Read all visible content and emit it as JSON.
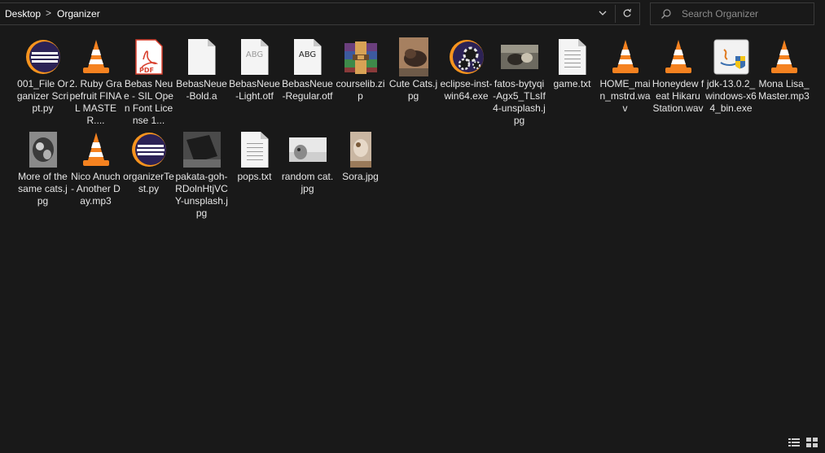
{
  "window": {
    "bg": "#191919",
    "text_color": "#e6e6e6"
  },
  "address_bar": {
    "breadcrumbs": [
      "Desktop",
      "Organizer"
    ],
    "separator": ">",
    "dropdown_glyph": "chevron-down-icon",
    "refresh_glyph": "refresh-icon"
  },
  "search": {
    "placeholder": "Search Organizer",
    "value": ""
  },
  "items": [
    {
      "label": "001_File Organizer Script.py",
      "icon": "python-eclipse-icon"
    },
    {
      "label": "2. Ruby Grapefruit FINAL MASTER....",
      "icon": "vlc-cone-icon"
    },
    {
      "label": "Bebas Neue - SIL Open Font License 1...",
      "icon": "pdf-icon"
    },
    {
      "label": "BebasNeue-Bold.a",
      "icon": "blank-file-icon"
    },
    {
      "label": "BebasNeue-Light.otf",
      "icon": "font-file-icon"
    },
    {
      "label": "BebasNeue-Regular.otf",
      "icon": "font-file-icon"
    },
    {
      "label": "courselib.zip",
      "icon": "archive-icon"
    },
    {
      "label": "Cute Cats.jpg",
      "icon": "photo-icon"
    },
    {
      "label": "eclipse-inst-win64.exe",
      "icon": "eclipse-installer-icon"
    },
    {
      "label": "fatos-bytyqi-Agx5_TLsIf4-unsplash.jpg",
      "icon": "photo-icon"
    },
    {
      "label": "game.txt",
      "icon": "text-file-icon"
    },
    {
      "label": "HOME_main_mstrd.wav",
      "icon": "vlc-cone-icon"
    },
    {
      "label": "Honeydew feat Hikaru Station.wav",
      "icon": "vlc-cone-icon"
    },
    {
      "label": "jdk-13.0.2_windows-x64_bin.exe",
      "icon": "java-installer-icon"
    },
    {
      "label": "Mona Lisa_Master.mp3",
      "icon": "vlc-cone-icon"
    },
    {
      "label": "More of the same cats.jpg",
      "icon": "photo-icon"
    },
    {
      "label": "Nico Anuch - Another Day.mp3",
      "icon": "vlc-cone-icon"
    },
    {
      "label": "organizerTest.py",
      "icon": "python-eclipse-icon"
    },
    {
      "label": "pakata-goh-RDolnHtjVCY-unsplash.jpg",
      "icon": "photo-icon"
    },
    {
      "label": "pops.txt",
      "icon": "text-file-icon"
    },
    {
      "label": "random cat.jpg",
      "icon": "photo-icon"
    },
    {
      "label": "Sora.jpg",
      "icon": "photo-icon"
    }
  ],
  "status_bar": {
    "view_buttons": [
      "details-view-icon",
      "large-icons-view-icon"
    ]
  }
}
